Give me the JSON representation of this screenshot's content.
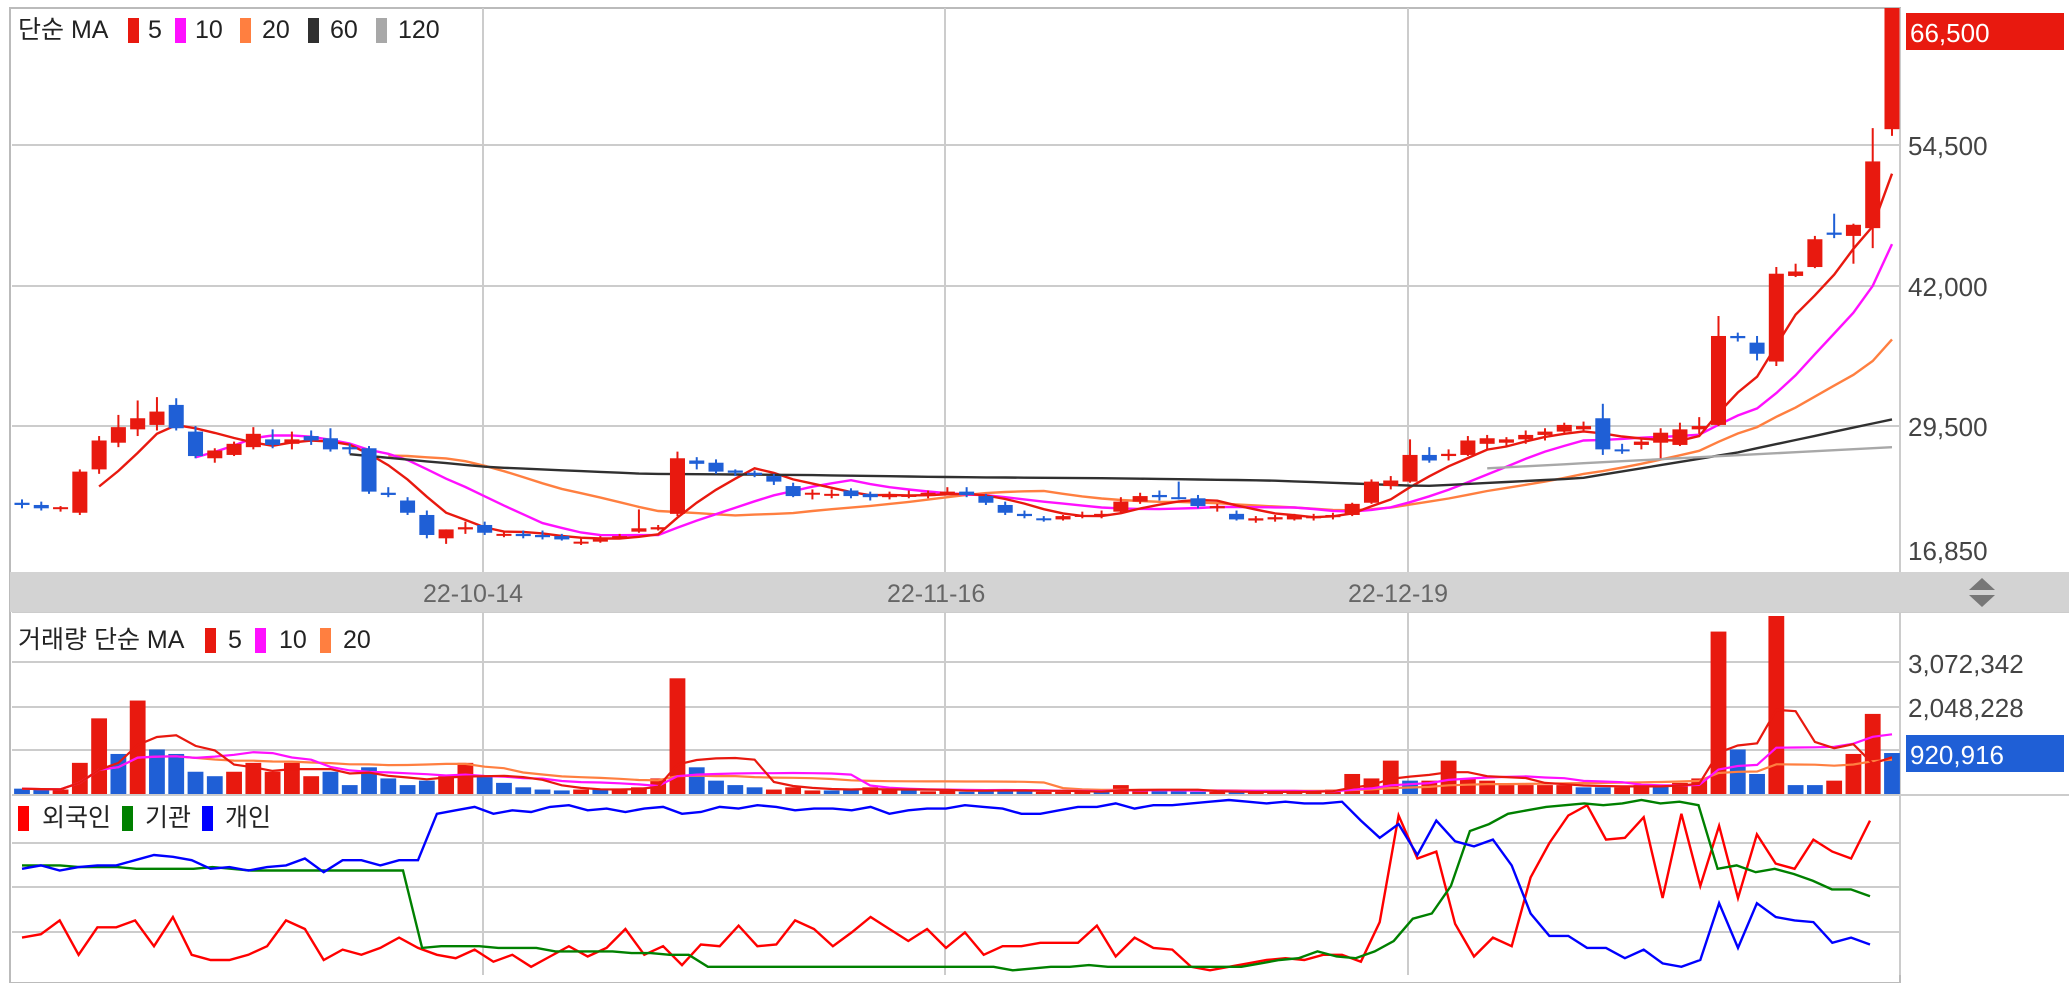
{
  "colors": {
    "up": "#e8190f",
    "down": "#1f5fd6",
    "ma5": "#e8190f",
    "ma10": "#ff10ff",
    "ma20": "#ff7f40",
    "ma60": "#303030",
    "ma120": "#a8a8a8",
    "foreign": "#ff0000",
    "institution": "#008000",
    "individual": "#0000ff",
    "grid": "#cccccc"
  },
  "price_panel": {
    "legend_title": "단순 MA",
    "legend": [
      {
        "label": "5",
        "color": "#e8190f"
      },
      {
        "label": "10",
        "color": "#ff10ff"
      },
      {
        "label": "20",
        "color": "#ff7f40"
      },
      {
        "label": "60",
        "color": "#303030"
      },
      {
        "label": "120",
        "color": "#a8a8a8"
      }
    ],
    "axis_labels": [
      "54,500",
      "42,000",
      "29,500",
      "16,850"
    ],
    "last_price": "66,500"
  },
  "dates": [
    "22-10-14",
    "22-11-16",
    "22-12-19"
  ],
  "volume_panel": {
    "legend_title": "거래량 단순 MA",
    "legend": [
      {
        "label": "5",
        "color": "#e8190f"
      },
      {
        "label": "10",
        "color": "#ff10ff"
      },
      {
        "label": "20",
        "color": "#ff7f40"
      }
    ],
    "axis_labels": [
      "3,072,342",
      "2,048,228"
    ],
    "last_volume": "920,916"
  },
  "investor_panel": {
    "legend": [
      {
        "label": "외국인",
        "color": "#ff0000"
      },
      {
        "label": "기관",
        "color": "#008000"
      },
      {
        "label": "개인",
        "color": "#0000ff"
      }
    ]
  },
  "chart_data": {
    "type": "candlestick",
    "y_range": [
      16850,
      66500
    ],
    "candles": [
      [
        22000,
        22300,
        21500,
        21800
      ],
      [
        21800,
        22100,
        21300,
        21500
      ],
      [
        21500,
        21700,
        21200,
        21600
      ],
      [
        21100,
        25000,
        20900,
        24800
      ],
      [
        25000,
        28000,
        24600,
        27600
      ],
      [
        27400,
        29900,
        27000,
        28800
      ],
      [
        28600,
        31200,
        28000,
        29600
      ],
      [
        29000,
        31500,
        28500,
        30200
      ],
      [
        30800,
        31400,
        28500,
        28700
      ],
      [
        28400,
        28900,
        26000,
        26200
      ],
      [
        26000,
        26900,
        25600,
        26700
      ],
      [
        26300,
        27500,
        26200,
        27300
      ],
      [
        27000,
        28800,
        26800,
        28200
      ],
      [
        27700,
        28600,
        26900,
        27200
      ],
      [
        27300,
        28400,
        26800,
        27700
      ],
      [
        28000,
        28500,
        27200,
        27600
      ],
      [
        27800,
        28700,
        26600,
        26800
      ],
      [
        27000,
        27300,
        26400,
        26800
      ],
      [
        26900,
        27100,
        22800,
        23000
      ],
      [
        22900,
        23400,
        22500,
        22700
      ],
      [
        22200,
        22500,
        20900,
        21100
      ],
      [
        20900,
        21300,
        18800,
        19100
      ],
      [
        18800,
        19600,
        18300,
        19600
      ],
      [
        19600,
        20300,
        19200,
        19800
      ],
      [
        20000,
        20300,
        19100,
        19300
      ],
      [
        19100,
        19500,
        18900,
        19200
      ],
      [
        19200,
        19500,
        18800,
        19000
      ],
      [
        19100,
        19500,
        18700,
        18900
      ],
      [
        19000,
        19200,
        18600,
        18700
      ],
      [
        18500,
        18900,
        18200,
        18500
      ],
      [
        18500,
        19000,
        18400,
        18800
      ],
      [
        18900,
        19200,
        18700,
        19000
      ],
      [
        19400,
        21400,
        19300,
        19700
      ],
      [
        19600,
        20000,
        19500,
        19800
      ],
      [
        21000,
        26600,
        20800,
        26000
      ],
      [
        25800,
        26100,
        25000,
        25500
      ],
      [
        25600,
        25900,
        24600,
        24800
      ],
      [
        24900,
        25000,
        24400,
        24700
      ],
      [
        24700,
        24900,
        24300,
        24500
      ],
      [
        24400,
        24600,
        23600,
        23900
      ],
      [
        23500,
        23800,
        22500,
        22600
      ],
      [
        22800,
        23200,
        22300,
        22900
      ],
      [
        22700,
        23200,
        22400,
        22800
      ],
      [
        23100,
        23300,
        22400,
        22600
      ],
      [
        22800,
        23000,
        22200,
        22500
      ],
      [
        22500,
        23000,
        22300,
        22700
      ],
      [
        22700,
        23100,
        22400,
        22700
      ],
      [
        22600,
        23100,
        22400,
        22900
      ],
      [
        22900,
        23400,
        22700,
        23000
      ],
      [
        23000,
        23400,
        22500,
        22700
      ],
      [
        22600,
        22800,
        21800,
        22000
      ],
      [
        21800,
        22100,
        20900,
        21100
      ],
      [
        21000,
        21300,
        20600,
        20800
      ],
      [
        20600,
        20800,
        20300,
        20500
      ],
      [
        20500,
        20900,
        20400,
        20800
      ],
      [
        20800,
        21200,
        20600,
        20900
      ],
      [
        20900,
        21300,
        20600,
        21000
      ],
      [
        21200,
        22500,
        21100,
        22100
      ],
      [
        22100,
        22900,
        21900,
        22600
      ],
      [
        22700,
        23100,
        22200,
        22500
      ],
      [
        22500,
        23900,
        22300,
        22400
      ],
      [
        22400,
        22700,
        21500,
        21700
      ],
      [
        21500,
        21900,
        21200,
        21700
      ],
      [
        21000,
        21300,
        20400,
        20500
      ],
      [
        20400,
        20800,
        20200,
        20600
      ],
      [
        20500,
        20900,
        20300,
        20700
      ],
      [
        20500,
        21000,
        20400,
        20900
      ],
      [
        20600,
        21000,
        20400,
        20800
      ],
      [
        20700,
        21100,
        20500,
        20900
      ],
      [
        20900,
        22000,
        20800,
        21900
      ],
      [
        22000,
        24100,
        21900,
        23900
      ],
      [
        23500,
        24400,
        23200,
        24000
      ],
      [
        23900,
        27700,
        23800,
        26300
      ],
      [
        26300,
        27000,
        25600,
        25800
      ],
      [
        26200,
        26800,
        25800,
        26400
      ],
      [
        26300,
        28000,
        26200,
        27600
      ],
      [
        27300,
        28100,
        26800,
        27800
      ],
      [
        27400,
        27900,
        27000,
        27700
      ],
      [
        27700,
        28500,
        27300,
        28100
      ],
      [
        28100,
        28700,
        27600,
        28400
      ],
      [
        28400,
        29200,
        28300,
        29000
      ],
      [
        28600,
        29300,
        28500,
        28900
      ],
      [
        29600,
        30900,
        26300,
        26800
      ],
      [
        26800,
        27300,
        26400,
        26700
      ],
      [
        27200,
        27800,
        26800,
        27500
      ],
      [
        27400,
        28700,
        26000,
        28300
      ],
      [
        27200,
        29200,
        27100,
        28600
      ],
      [
        28600,
        29700,
        28200,
        28900
      ],
      [
        29000,
        38800,
        28900,
        37000
      ],
      [
        37000,
        37300,
        36500,
        36800
      ],
      [
        36400,
        37000,
        34800,
        35400
      ],
      [
        34700,
        43200,
        34300,
        42600
      ],
      [
        42400,
        43500,
        42300,
        42800
      ],
      [
        43200,
        46000,
        43100,
        45700
      ],
      [
        46300,
        48000,
        45800,
        46100
      ],
      [
        46000,
        47100,
        43500,
        47000
      ],
      [
        46700,
        55700,
        44900,
        52700
      ],
      [
        55600,
        66500,
        55000,
        66500
      ]
    ],
    "volume_max": 4000000,
    "volumes": [
      [
        120000,
        0
      ],
      [
        100000,
        0
      ],
      [
        100000,
        1
      ],
      [
        700000,
        1
      ],
      [
        1700000,
        1
      ],
      [
        900000,
        0
      ],
      [
        2100000,
        1
      ],
      [
        1000000,
        0
      ],
      [
        900000,
        0
      ],
      [
        500000,
        0
      ],
      [
        400000,
        0
      ],
      [
        500000,
        1
      ],
      [
        700000,
        1
      ],
      [
        500000,
        1
      ],
      [
        700000,
        1
      ],
      [
        400000,
        1
      ],
      [
        500000,
        0
      ],
      [
        200000,
        0
      ],
      [
        600000,
        0
      ],
      [
        350000,
        0
      ],
      [
        200000,
        0
      ],
      [
        300000,
        0
      ],
      [
        400000,
        1
      ],
      [
        700000,
        1
      ],
      [
        400000,
        0
      ],
      [
        250000,
        0
      ],
      [
        150000,
        0
      ],
      [
        100000,
        0
      ],
      [
        80000,
        0
      ],
      [
        100000,
        1
      ],
      [
        100000,
        0
      ],
      [
        120000,
        1
      ],
      [
        150000,
        1
      ],
      [
        350000,
        1
      ],
      [
        2600000,
        1
      ],
      [
        600000,
        0
      ],
      [
        300000,
        0
      ],
      [
        200000,
        0
      ],
      [
        150000,
        0
      ],
      [
        100000,
        1
      ],
      [
        150000,
        1
      ],
      [
        80000,
        1
      ],
      [
        80000,
        0
      ],
      [
        100000,
        0
      ],
      [
        150000,
        1
      ],
      [
        100000,
        1
      ],
      [
        80000,
        0
      ],
      [
        60000,
        1
      ],
      [
        80000,
        1
      ],
      [
        50000,
        0
      ],
      [
        100000,
        0
      ],
      [
        100000,
        0
      ],
      [
        60000,
        0
      ],
      [
        50000,
        1
      ],
      [
        50000,
        1
      ],
      [
        60000,
        1
      ],
      [
        50000,
        0
      ],
      [
        200000,
        1
      ],
      [
        100000,
        1
      ],
      [
        70000,
        0
      ],
      [
        60000,
        0
      ],
      [
        50000,
        0
      ],
      [
        50000,
        1
      ],
      [
        40000,
        0
      ],
      [
        50000,
        1
      ],
      [
        50000,
        1
      ],
      [
        50000,
        1
      ],
      [
        60000,
        1
      ],
      [
        100000,
        1
      ],
      [
        450000,
        1
      ],
      [
        350000,
        1
      ],
      [
        750000,
        1
      ],
      [
        300000,
        0
      ],
      [
        300000,
        1
      ],
      [
        750000,
        1
      ],
      [
        350000,
        1
      ],
      [
        300000,
        1
      ],
      [
        200000,
        1
      ],
      [
        200000,
        1
      ],
      [
        200000,
        1
      ],
      [
        200000,
        1
      ],
      [
        150000,
        0
      ],
      [
        150000,
        0
      ],
      [
        150000,
        1
      ],
      [
        200000,
        1
      ],
      [
        200000,
        0
      ],
      [
        250000,
        1
      ],
      [
        350000,
        1
      ],
      [
        3650000,
        1
      ],
      [
        1000000,
        0
      ],
      [
        450000,
        0
      ],
      [
        4000000,
        1
      ],
      [
        200000,
        0
      ],
      [
        200000,
        0
      ],
      [
        300000,
        1
      ],
      [
        900000,
        1
      ],
      [
        1800000,
        1
      ],
      [
        920916,
        0
      ]
    ],
    "investor_range": [
      0,
      100
    ],
    "foreign": [
      20,
      22,
      30,
      10,
      26,
      26,
      30,
      15,
      32,
      10,
      7,
      7,
      10,
      15,
      30,
      25,
      7,
      13,
      10,
      14,
      20,
      14,
      10,
      8,
      13,
      6,
      10,
      3,
      9,
      15,
      9,
      14,
      25,
      10,
      15,
      4,
      16,
      15,
      27,
      15,
      16,
      30,
      25,
      15,
      23,
      32,
      25,
      18,
      25,
      14,
      23,
      10,
      15,
      15,
      17,
      17,
      17,
      27,
      9,
      20,
      14,
      13,
      3,
      1,
      3,
      5,
      7,
      8,
      7,
      10,
      10,
      6,
      29,
      91,
      66,
      70,
      28,
      9,
      20,
      15,
      55,
      75,
      91,
      97,
      77,
      78,
      90,
      43,
      92,
      50,
      85,
      43,
      80,
      63,
      60,
      77,
      70,
      66,
      88
    ],
    "institution": [
      62,
      62,
      62,
      61,
      61,
      61,
      60,
      60,
      60,
      60,
      61,
      60,
      59,
      59,
      59,
      59,
      59,
      59,
      59,
      59,
      59,
      14,
      15,
      15,
      15,
      14,
      14,
      14,
      12,
      12,
      12,
      12,
      11,
      11,
      10,
      10,
      3,
      3,
      3,
      3,
      3,
      3,
      3,
      3,
      3,
      3,
      3,
      3,
      3,
      3,
      3,
      3,
      1,
      2,
      3,
      3,
      4,
      3,
      3,
      3,
      3,
      3,
      3,
      3,
      3,
      5,
      7,
      8,
      12,
      9,
      8,
      12,
      18,
      31,
      34,
      50,
      82,
      86,
      92,
      94,
      96,
      97,
      98,
      97,
      98,
      100,
      98,
      99,
      97,
      60,
      62,
      58,
      60,
      57,
      53,
      48,
      48,
      44
    ],
    "individual": [
      60,
      62,
      59,
      61,
      62,
      62,
      65,
      68,
      67,
      65,
      60,
      61,
      59,
      61,
      62,
      66,
      58,
      65,
      65,
      62,
      65,
      65,
      92,
      94,
      96,
      92,
      94,
      93,
      96,
      97,
      94,
      95,
      93,
      95,
      96,
      92,
      93,
      96,
      95,
      97,
      96,
      94,
      95,
      95,
      94,
      96,
      92,
      94,
      95,
      95,
      97,
      96,
      95,
      92,
      92,
      94,
      96,
      96,
      98,
      95,
      97,
      97,
      98,
      99,
      100,
      99,
      98,
      99,
      98,
      98,
      99,
      88,
      78,
      86,
      68,
      88,
      76,
      73,
      77,
      62,
      34,
      21,
      21,
      14,
      14,
      8,
      13,
      5,
      3,
      7,
      40,
      14,
      40,
      32,
      30,
      29,
      17,
      20,
      16
    ]
  }
}
